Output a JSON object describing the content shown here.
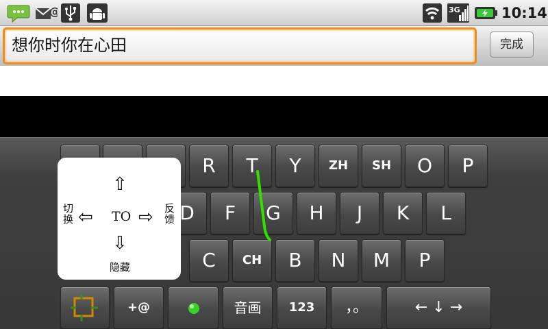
{
  "statusbar": {
    "time": "10:14",
    "icons": [
      "sms-icon",
      "mail-icon",
      "usb-icon",
      "android-debug-icon",
      "wifi-icon",
      "3g-signal-icon",
      "battery-charging-icon"
    ],
    "signal_label": "3G"
  },
  "input": {
    "text": "想你时你在心田",
    "done_label": "完成"
  },
  "keyboard": {
    "row1": [
      "R",
      "T",
      "Y",
      "ZH",
      "SH",
      "O",
      "P"
    ],
    "row2": [
      "D",
      "F",
      "G",
      "H",
      "J",
      "K",
      "L"
    ],
    "row3": [
      "C",
      "CH",
      "B",
      "N",
      "M",
      "P"
    ],
    "row4": {
      "plus_at": "+@",
      "sound_draw": "音画",
      "numbers": "123",
      "punct": "，。",
      "arrows": "← ↓ →"
    }
  },
  "popup": {
    "left": "切换",
    "right": "反馈",
    "down": "隐藏",
    "center": "TO",
    "arrows": {
      "up": "⇧",
      "down": "⇩",
      "left": "⇦",
      "right": "⇨"
    }
  },
  "colors": {
    "accent_orange": "#f08c1e",
    "trace_green": "#2fe000",
    "battery_green": "#3cc83c"
  }
}
